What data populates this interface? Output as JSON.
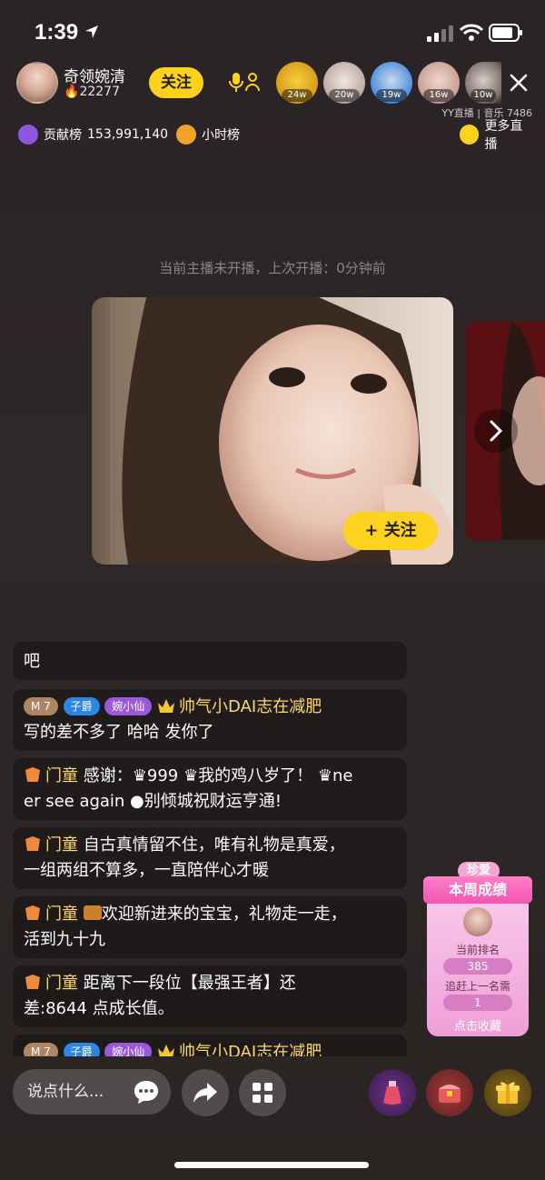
{
  "status_bar": {
    "time": "1:39"
  },
  "host": {
    "name": "奇领婉清",
    "fans": "22277",
    "follow_label": "关注"
  },
  "viewers": [
    {
      "badge": "24w",
      "color": "#f0c531"
    },
    {
      "badge": "20w",
      "color": "#c7b9b6"
    },
    {
      "badge": "19w",
      "color": "#4c8fdd"
    },
    {
      "badge": "16w",
      "color": "#c89f92"
    },
    {
      "badge": "10w",
      "color": "#7c6d69"
    }
  ],
  "yy_label": "YY直播 | 音乐 7486",
  "rank": {
    "contribution_label": "贡献榜",
    "contribution_value": "153,991,140",
    "hourly_label": "小时榜",
    "more_label": "更多直播"
  },
  "notice": "当前主播未开播，上次开播：0分钟前",
  "card": {
    "follow_label": "+ 关注"
  },
  "chat": {
    "partial_top": "吧",
    "messages": [
      {
        "level": "7",
        "title": "子爵",
        "fan_tag": "婉小仙",
        "user": "帅气小DAI志在减肥",
        "text": "写的差不多了 哈哈 发你了"
      },
      {
        "user": "门童",
        "line1": "感谢：♛999 ♛我的鸡八岁了！ ♛ne",
        "line2": "er see again ●别倾城祝财运亨通!"
      },
      {
        "user": "门童",
        "line1": "自古真情留不住，唯有礼物是真爱，",
        "line2": "一组两组不算多，一直陪伴心才暖"
      },
      {
        "user": "门童",
        "line1": "欢迎新进来的宝宝，礼物走一走，",
        "line2": "活到九十九"
      },
      {
        "user": "门童",
        "line1": "距离下一段位【最强王者】还",
        "line2": "差:8644 点成长值。"
      },
      {
        "level": "7",
        "title": "子爵",
        "fan_tag": "婉小仙",
        "user": "帅气小DAI志在减肥"
      }
    ]
  },
  "weekly": {
    "top_tag": "珍爱",
    "title": "本周成绩",
    "rank_label": "当前排名",
    "rank_value": "385",
    "catchup_label": "追赶上一名需",
    "catchup_value": "1",
    "footer": "点击收藏"
  },
  "bottom": {
    "input_placeholder": "说点什么..."
  },
  "colors": {
    "accent_yellow": "#ffd21e",
    "user_gold": "#ffd76a",
    "weekly_pink": "#f454b0"
  }
}
